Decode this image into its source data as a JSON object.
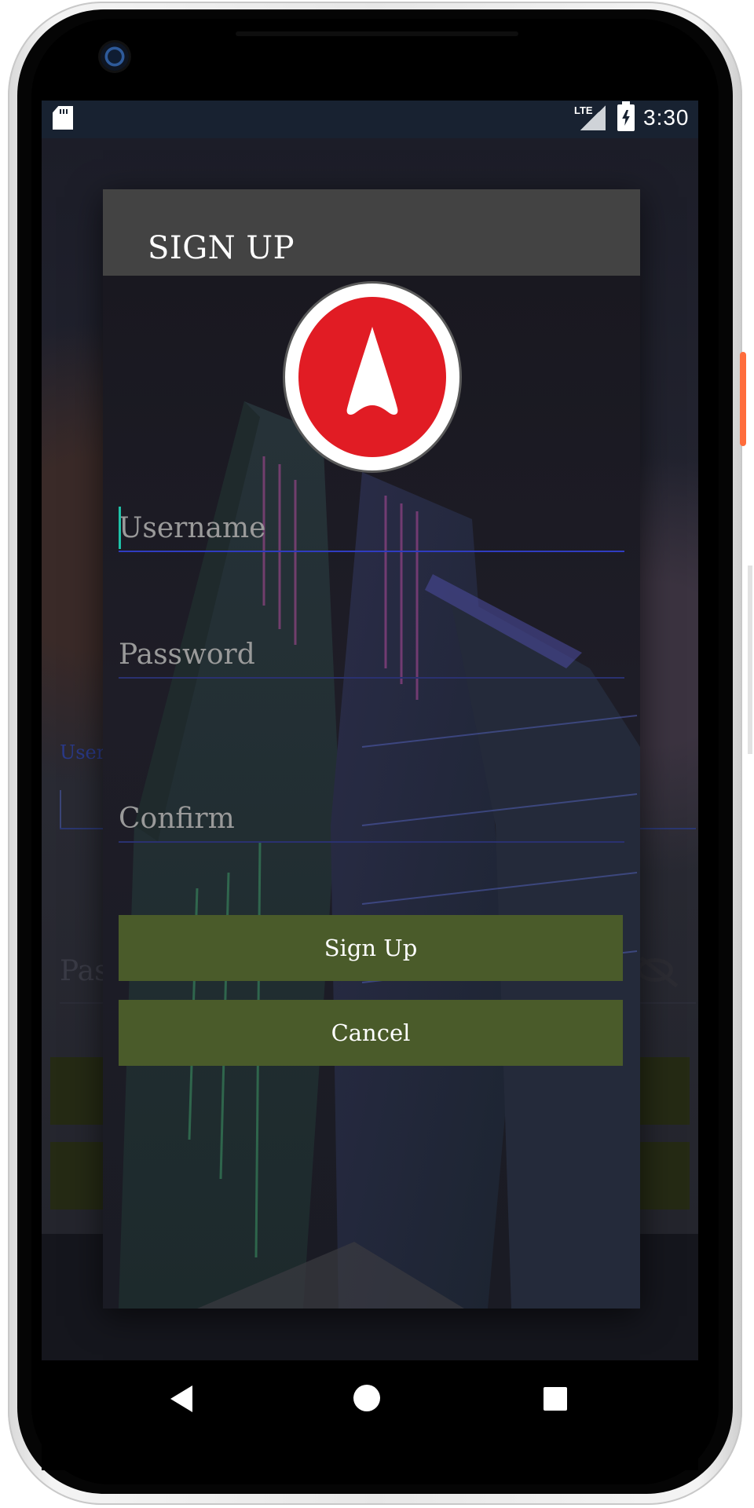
{
  "status_bar": {
    "network_label": "LTE",
    "time": "3:30",
    "icons": [
      "sd-card-icon",
      "signal-icon",
      "battery-charging-icon"
    ]
  },
  "background_screen": {
    "username_label": "Usern",
    "password_label": "Pas"
  },
  "dialog": {
    "title": "SIGN UP",
    "logo": "navigation-arrow-logo",
    "fields": {
      "username": {
        "placeholder": "Username",
        "value": ""
      },
      "password": {
        "placeholder": "Password",
        "value": ""
      },
      "confirm": {
        "placeholder": "Confirm",
        "value": ""
      }
    },
    "buttons": {
      "sign_up": "Sign Up",
      "cancel": "Cancel"
    }
  },
  "nav_bar": {
    "icons": [
      "back-icon",
      "home-icon",
      "recents-icon"
    ]
  },
  "colors": {
    "status_bar": "#182231",
    "dialog_header": "#434343",
    "button": "#4a5b2a",
    "logo_red": "#e11c24",
    "field_underline": "#2a3170",
    "caret": "#1ec2a8"
  }
}
